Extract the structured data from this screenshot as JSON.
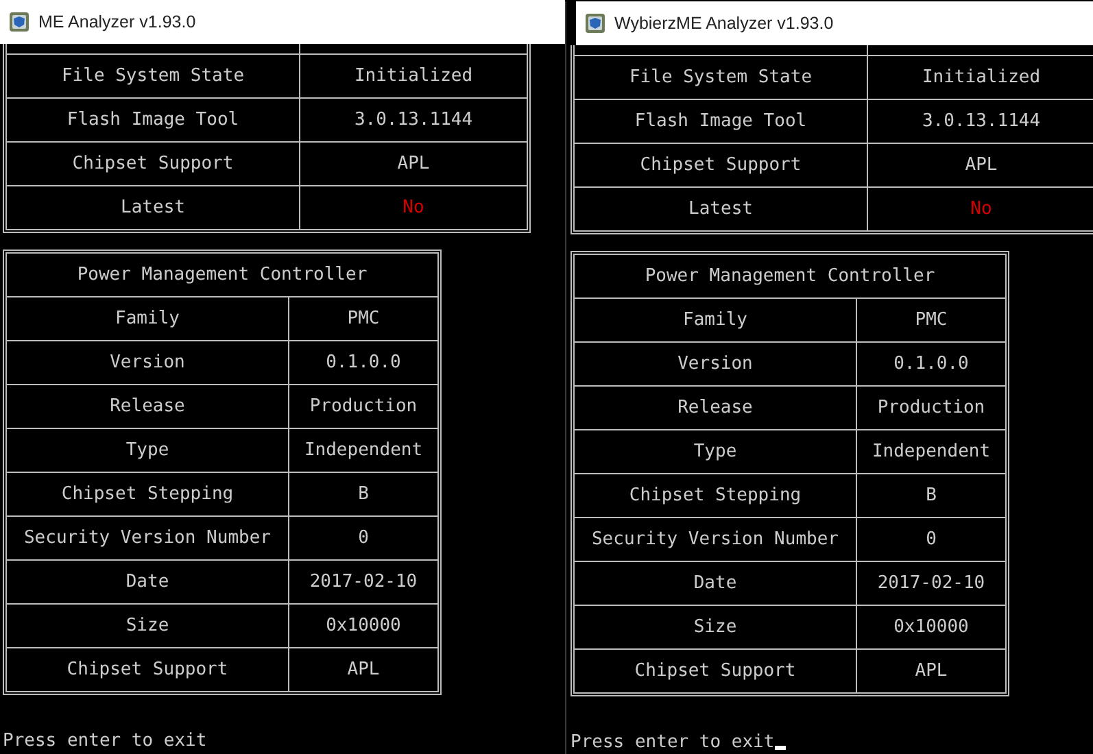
{
  "windows": [
    {
      "title": "ME Analyzer v1.93.0",
      "cursor": false,
      "engine_table": {
        "rows": [
          {
            "label": "File System State",
            "value": "Initialized",
            "alert": false
          },
          {
            "label": "Flash Image Tool",
            "value": "3.0.13.1144",
            "alert": false
          },
          {
            "label": "Chipset Support",
            "value": "APL",
            "alert": false
          },
          {
            "label": "Latest",
            "value": "No",
            "alert": true
          }
        ]
      },
      "pmc_table": {
        "title": "Power Management Controller",
        "rows": [
          {
            "label": "Family",
            "value": "PMC"
          },
          {
            "label": "Version",
            "value": "0.1.0.0"
          },
          {
            "label": "Release",
            "value": "Production"
          },
          {
            "label": "Type",
            "value": "Independent"
          },
          {
            "label": "Chipset Stepping",
            "value": "B"
          },
          {
            "label": "Security Version Number",
            "value": "0"
          },
          {
            "label": "Date",
            "value": "2017-02-10"
          },
          {
            "label": "Size",
            "value": "0x10000"
          },
          {
            "label": "Chipset Support",
            "value": "APL"
          }
        ]
      },
      "prompt": "Press enter to exit"
    },
    {
      "title": "WybierzME Analyzer v1.93.0",
      "cursor": true,
      "engine_table": {
        "rows": [
          {
            "label": "File System State",
            "value": "Initialized",
            "alert": false
          },
          {
            "label": "Flash Image Tool",
            "value": "3.0.13.1144",
            "alert": false
          },
          {
            "label": "Chipset Support",
            "value": "APL",
            "alert": false
          },
          {
            "label": "Latest",
            "value": "No",
            "alert": true
          }
        ]
      },
      "pmc_table": {
        "title": "Power Management Controller",
        "rows": [
          {
            "label": "Family",
            "value": "PMC"
          },
          {
            "label": "Version",
            "value": "0.1.0.0"
          },
          {
            "label": "Release",
            "value": "Production"
          },
          {
            "label": "Type",
            "value": "Independent"
          },
          {
            "label": "Chipset Stepping",
            "value": "B"
          },
          {
            "label": "Security Version Number",
            "value": "0"
          },
          {
            "label": "Date",
            "value": "2017-02-10"
          },
          {
            "label": "Size",
            "value": "0x10000"
          },
          {
            "label": "Chipset Support",
            "value": "APL"
          }
        ]
      },
      "prompt": "Press enter to exit"
    }
  ]
}
